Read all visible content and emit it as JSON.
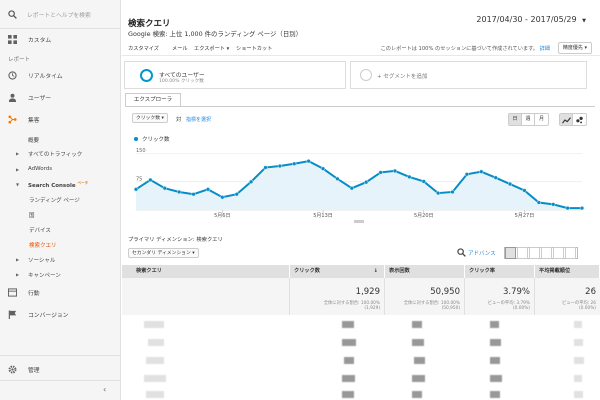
{
  "sidebar": {
    "search_placeholder": "レポートとヘルプを検索",
    "custom": "カスタム",
    "report_header": "レポート",
    "realtime": "リアルタイム",
    "users": "ユーザー",
    "acquisition": "集客",
    "overview": "概要",
    "all_traffic": "すべてのトラフィック",
    "adwords": "AdWords",
    "search_console": "Search Console",
    "search_console_badge": "ベータ",
    "landing_pages": "ランディング ページ",
    "countries": "国",
    "devices": "デバイス",
    "queries": "検索クエリ",
    "social": "ソーシャル",
    "campaigns": "キャンペーン",
    "behavior": "行動",
    "conversions": "コンバージョン",
    "admin": "管理"
  },
  "header": {
    "title": "検索クエリ",
    "subtitle": "Google 検索: 上位 1,000 件のランディング ページ（日別）",
    "date_range": "2017/04/30 - 2017/05/29"
  },
  "toolbar": {
    "customize": "カスタマイズ",
    "email": "メール",
    "export": "エクスポート ▾",
    "shortcut": "ショートカット",
    "note": "このレポートは 100% のセッションに基づいて作成されています。",
    "detail": "詳細",
    "precision": "精度優先 ▾"
  },
  "segments": {
    "all_users": "すべてのユーザー",
    "all_users_pct": "100.00% クリック数",
    "add_segment": "+ セグメントを追加"
  },
  "explorer": {
    "tab": "エクスプローラ",
    "metric1": "クリック数 ▾",
    "vs": "対",
    "select_metric": "指標を選択",
    "period_day": "日",
    "period_week": "週",
    "period_month": "月",
    "legend": "クリック数"
  },
  "chart_data": {
    "type": "line",
    "title": "",
    "ylabel": "",
    "xlabel": "",
    "yticks": [
      75,
      150
    ],
    "ylim": [
      0,
      165
    ],
    "x_tick_labels": [
      "5月6日",
      "5月13日",
      "5月20日",
      "5月27日"
    ],
    "x_tick_index": [
      6,
      13,
      20,
      27
    ],
    "series": [
      {
        "name": "クリック数",
        "color": "#058dc7",
        "values": [
          55,
          80,
          58,
          48,
          42,
          55,
          34,
          42,
          75,
          113,
          117,
          123,
          130,
          110,
          83,
          58,
          74,
          100,
          104,
          88,
          76,
          45,
          48,
          95,
          102,
          86,
          69,
          52,
          20,
          15,
          5,
          5
        ]
      }
    ]
  },
  "table": {
    "primary_dimension_label": "プライマリ ディメンション:",
    "primary_dimension_value": "検索クエリ",
    "secondary_dimension": "セカンダリ ディメンション ▾",
    "advanced": "アドバンス",
    "columns": [
      "検索クエリ",
      "クリック数",
      "表示回数",
      "クリック率",
      "平均掲載順位"
    ],
    "totals": [
      {
        "value": "1,929",
        "line1": "全体に対する割合: 100.00%",
        "line2": "(1,929)"
      },
      {
        "value": "50,950",
        "line1": "全体に対する割合: 100.00%",
        "line2": "(50,950)"
      },
      {
        "value": "3.79%",
        "line1": "ビューの平均: 3.79%",
        "line2": "(0.00%)"
      },
      {
        "value": "26",
        "line1": "ビューの平均: 26",
        "line2": "(0.00%)"
      }
    ]
  }
}
